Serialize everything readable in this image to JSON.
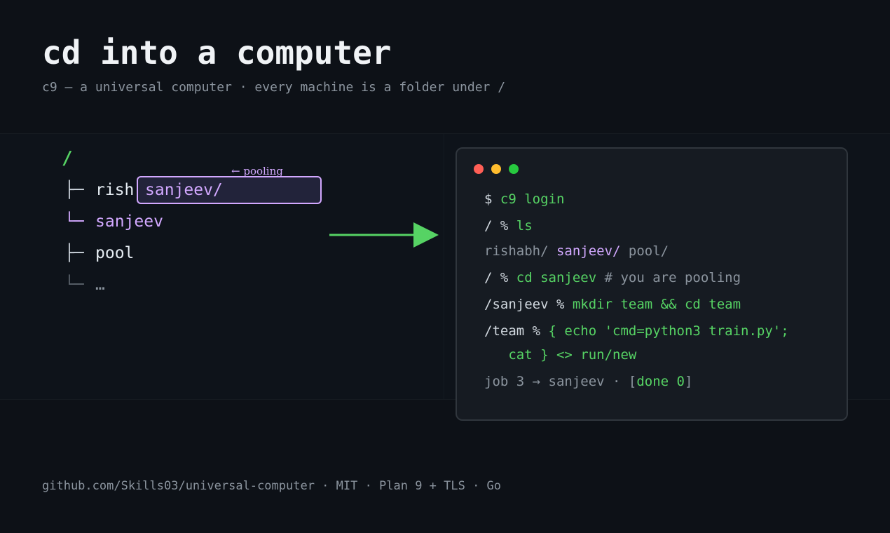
{
  "header": {
    "title": "cd into a computer",
    "subtitle": "c9 — a universal computer · every machine is a folder under /"
  },
  "tree": {
    "root": "/",
    "rows": [
      {
        "branch": "├─",
        "name": "rish"
      },
      {
        "branch": "└─",
        "name": "sanjeev"
      },
      {
        "branch": "├─",
        "name": "pool"
      },
      {
        "branch": "└─",
        "name": "…"
      }
    ],
    "drag_chip_label": "sanjeev/",
    "drag_hint": "← pooling"
  },
  "terminal": {
    "lines": {
      "l1": {
        "prompt": "$ ",
        "cmd": "c9 login"
      },
      "l2": {
        "prompt": "/ % ",
        "cmd": "ls"
      },
      "l3": {
        "a": "rishabh/ ",
        "b": "sanjeev/",
        "c": " pool/"
      },
      "l4": {
        "prompt": "/ % ",
        "cmd": "cd sanjeev",
        "comment": " # you are pooling"
      },
      "l5": {
        "prompt": "/sanjeev % ",
        "cmd": "mkdir team && cd team"
      },
      "l6": {
        "prompt": "/team % ",
        "cmd": "{ echo 'cmd=python3 train.py';"
      },
      "l7": {
        "cmd": "   cat } <> run/new"
      },
      "l8": {
        "a": "job 3 → sanjeev · [",
        "b": "done 0",
        "c": "]"
      }
    }
  },
  "footer": {
    "text": "github.com/Skills03/universal-computer · MIT · Plan 9 + TLS · Go"
  },
  "colors": {
    "background": "#0d1117",
    "accent_green": "#56d364",
    "accent_purple": "#d2a8ff",
    "muted": "#8b949e",
    "dot_red": "#ff5f56",
    "dot_yellow": "#ffbd2e",
    "dot_green": "#27c93f"
  }
}
